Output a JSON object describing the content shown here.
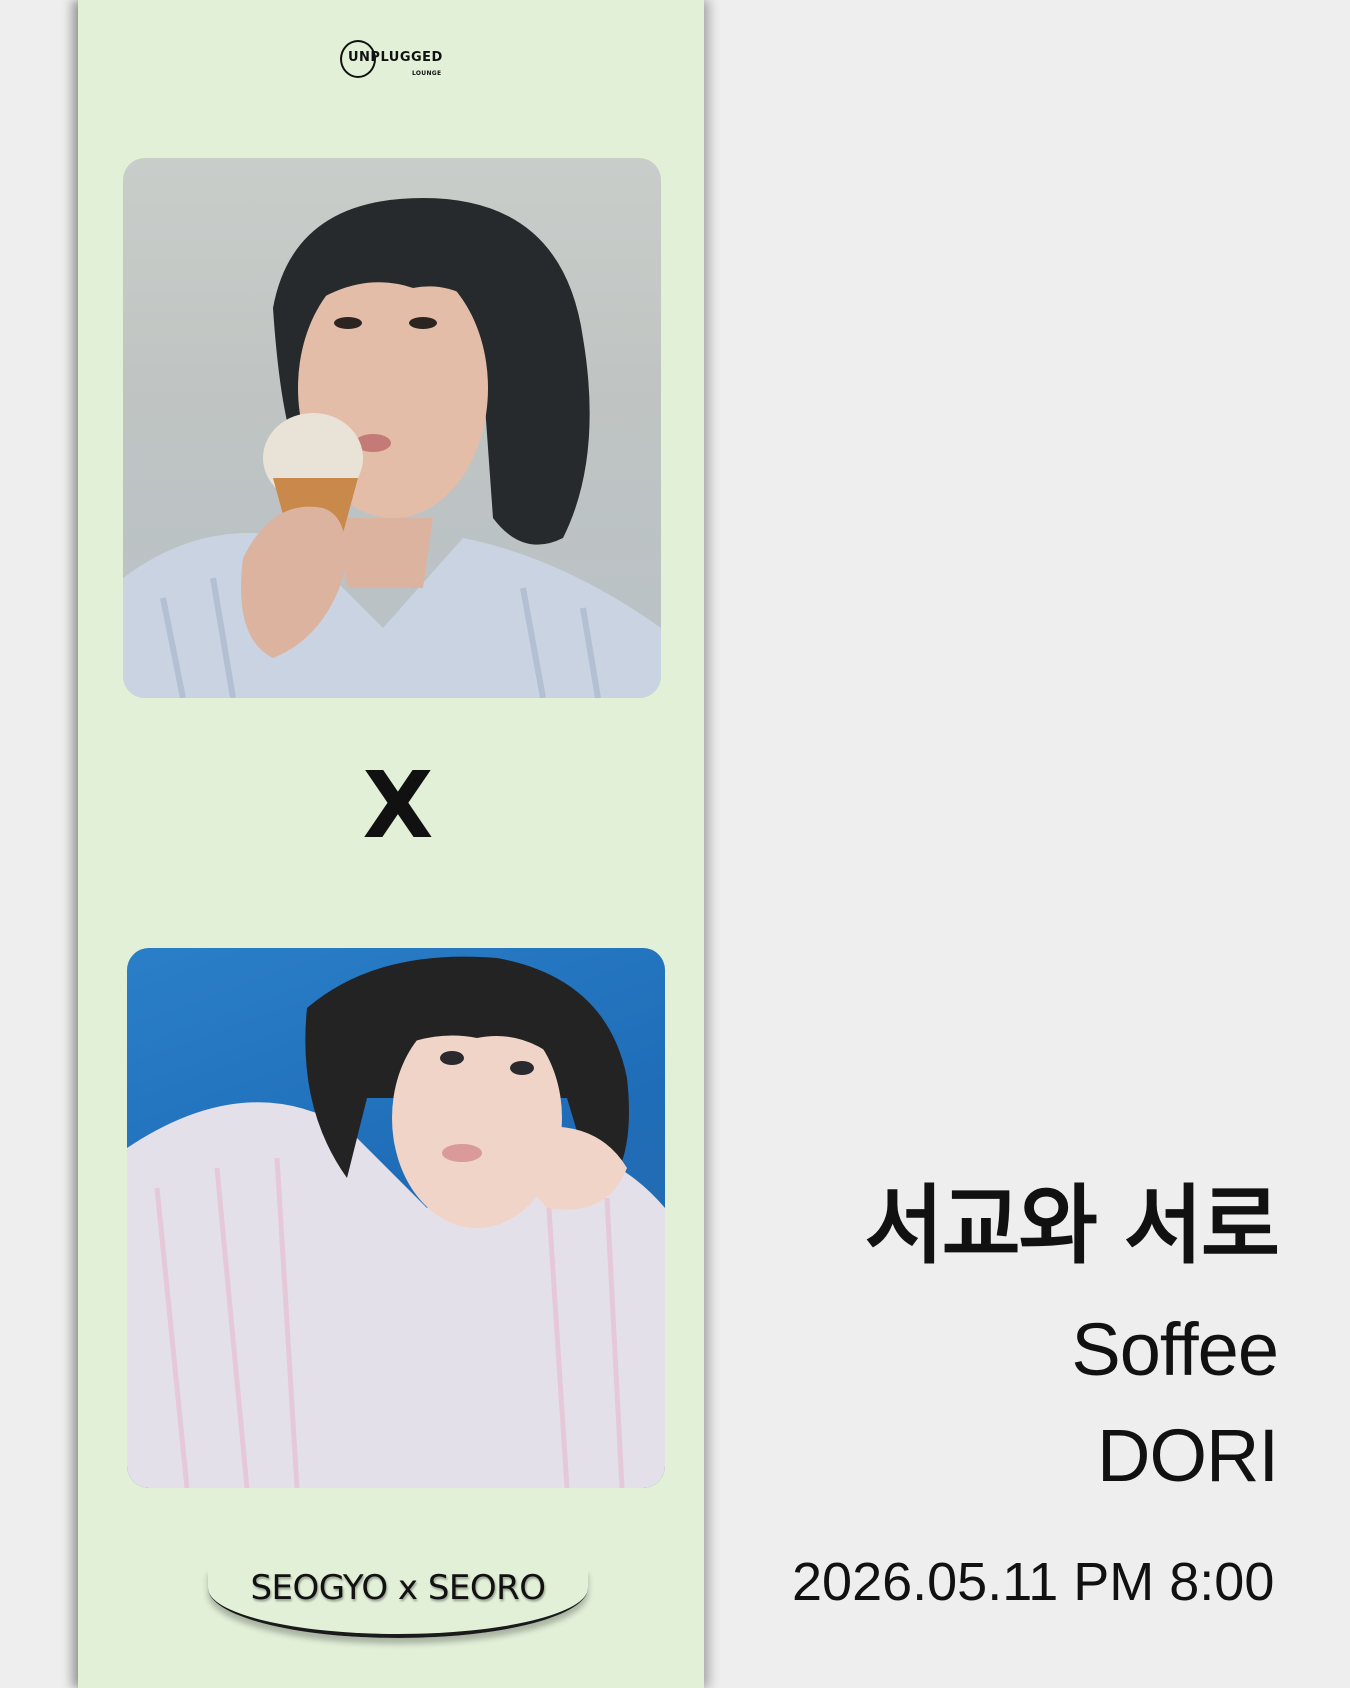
{
  "poster": {
    "logo": {
      "main": "UNPLUGGED",
      "sub": "LOUNGE"
    },
    "connector": "X",
    "badge_text": "SEOGYO x SEORO",
    "title": "서교와 서로",
    "artists": [
      "Soffee",
      "DORI"
    ],
    "datetime": "2026.05.11 PM 8:00"
  },
  "colors": {
    "background": "#eeeeee",
    "strip": "#e2f0d8",
    "text": "#111111",
    "photo_top_backdrop": "#c9cdca",
    "photo_bottom_backdrop": "#1f6db8"
  }
}
